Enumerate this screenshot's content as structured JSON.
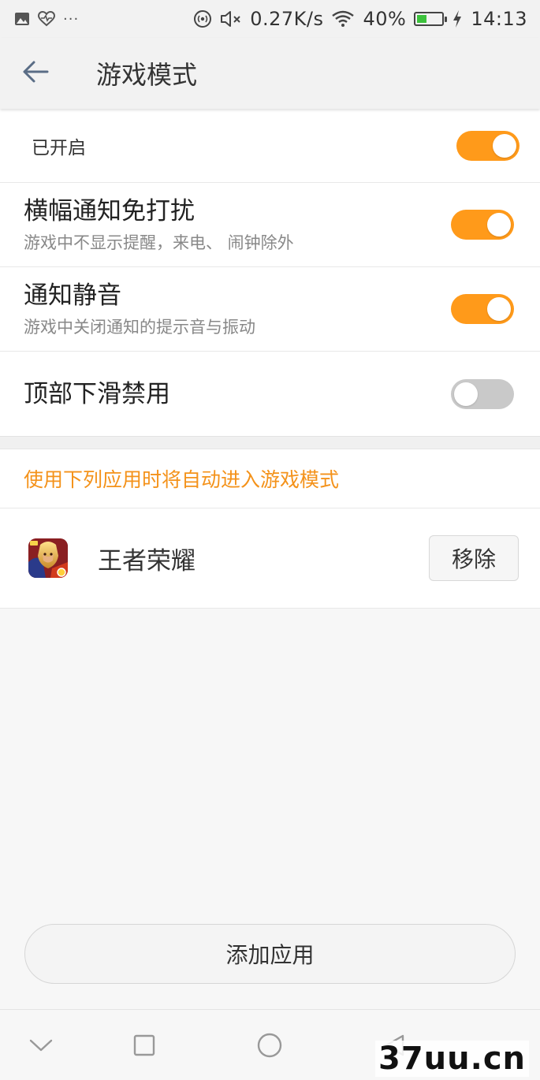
{
  "status_bar": {
    "left_icons": [
      "image-icon",
      "heart-monitor-icon",
      "more-dots-icon"
    ],
    "dots": "···",
    "net_speed": "0.27K/s",
    "battery_percent": "40%",
    "battery_level": 0.4,
    "time": "14:13",
    "right_icons": [
      "nfc-icon",
      "mute-icon",
      "wifi-icon",
      "battery-icon",
      "charging-icon"
    ]
  },
  "app_bar": {
    "title": "游戏模式",
    "back_icon": "arrow-left-icon"
  },
  "settings": {
    "enabled": {
      "label": "已开启",
      "on": true
    },
    "banner_dnd": {
      "title": "横幅通知免打扰",
      "subtitle": "游戏中不显示提醒，来电、 闹钟除外",
      "on": true
    },
    "notif_mute": {
      "title": "通知静音",
      "subtitle": "游戏中关闭通知的提示音与振动",
      "on": true
    },
    "pull_down_disable": {
      "title": "顶部下滑禁用",
      "on": false
    }
  },
  "apps_section": {
    "label": "使用下列应用时将自动进入游戏模式",
    "apps": [
      {
        "name": "王者荣耀",
        "remove_label": "移除"
      }
    ]
  },
  "add_button": {
    "label": "添加应用"
  },
  "colors": {
    "accent": "#ff9a1a",
    "label_orange": "#f4921a",
    "toggle_off": "#c9c9c9"
  },
  "nav_bar": {
    "icons": [
      "chevron-down-icon",
      "square-icon",
      "circle-icon",
      "triangle-back-icon"
    ]
  },
  "watermark": "37uu.cn"
}
